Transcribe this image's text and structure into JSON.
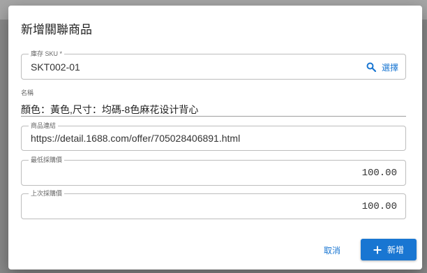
{
  "dialog": {
    "title": "新增關聯商品",
    "sku_field": {
      "label": "庫存 SKU *",
      "value": "SKT002-01",
      "select_label": "選擇"
    },
    "name_field": {
      "label": "名稱",
      "value": "顏色：黃色,尺寸：均碼-8色麻花设计背心"
    },
    "link_field": {
      "label": "商品連結",
      "value": "https://detail.1688.com/offer/705028406891.html"
    },
    "min_price_field": {
      "label": "最低採購價",
      "value": "100.00"
    },
    "last_price_field": {
      "label": "上次採購價",
      "value": "100.00"
    },
    "actions": {
      "cancel_label": "取消",
      "add_label": "新增"
    }
  },
  "colors": {
    "accent": "#1976d2",
    "border": "#bdbdbd",
    "overlay": "#8a8a8a"
  },
  "icons": {
    "select": "search-icon",
    "add": "plus-icon"
  }
}
